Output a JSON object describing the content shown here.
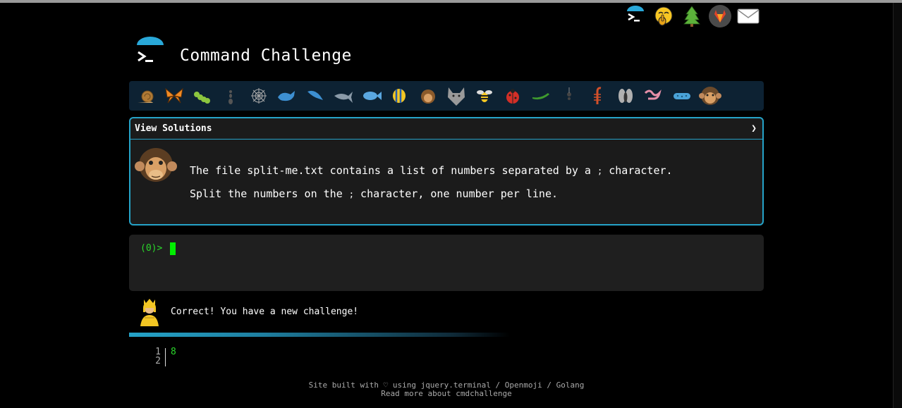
{
  "header": {
    "title": "Command Challenge",
    "top_icons": [
      "terminal-icon",
      "shushing-face-icon",
      "tree-icon",
      "gitlab-icon",
      "envelope-icon"
    ]
  },
  "animals": [
    "snail",
    "butterfly",
    "caterpillar",
    "ant",
    "spider-web",
    "whale",
    "dolphin",
    "shark",
    "fish",
    "tropical-fish",
    "hedgehog",
    "wolf",
    "bee",
    "ladybug",
    "cucumber",
    "spider",
    "scorpion",
    "fly",
    "worm",
    "microbe",
    "chimpanzee"
  ],
  "challenge_panel": {
    "header_label": "View Solutions",
    "toggle_glyph": "❯",
    "line1_pre": "The file split-me.txt contains a list of numbers separated by a ",
    "line1_semi": ";",
    "line1_post": " character.",
    "line2_pre": "Split the numbers on the ",
    "line2_semi": ";",
    "line2_post": " character, one number per line."
  },
  "terminal": {
    "prompt": "(0)>"
  },
  "feedback": {
    "message": "Correct! You have a new challenge!"
  },
  "output": {
    "line_numbers": [
      "1",
      "2"
    ],
    "value": "8"
  },
  "footer": {
    "line1": "Site built with ♡ using jquery.terminal / Openmoji / Golang",
    "line2": "Read more about cmdchallenge"
  },
  "colors": {
    "accent": "#25a3c8",
    "terminal_green": "#2bd82b",
    "panel_bg": "#1b1b1b"
  }
}
